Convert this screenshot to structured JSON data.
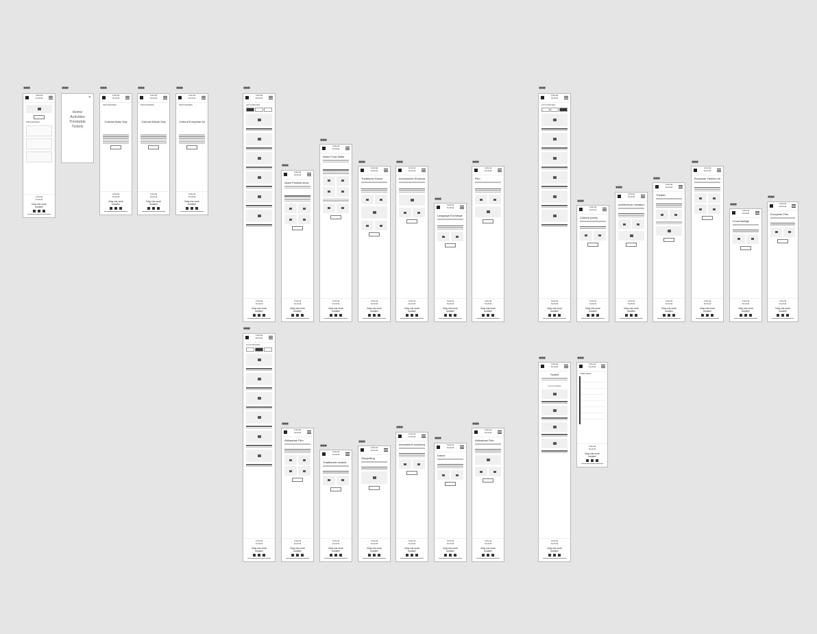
{
  "brand": "Cultural\nFestival",
  "menu_items": [
    "Home",
    "Activities",
    "Timetable",
    "Tickets"
  ],
  "titles": {
    "programma": "PROGRAMMA",
    "activiteiten": "ACTIVITEITEN",
    "tickets": "Tickets",
    "timetable": "TIMETABLE"
  },
  "pages": [
    "Cultural Asian Day",
    "Cultural African Day",
    "Cultural European Day",
    "Asian Festival show",
    "Asian Food Stalls",
    "Traditional Dance",
    "Accessories Showcase",
    "Language Exchange",
    "Film",
    "Cultural poetry",
    "Architecture miniature",
    "Theater",
    "European Fashion show",
    "Food tastings",
    "European Film",
    "Storytelling",
    "Interactieve workshop",
    "Dance",
    "Afrikaanse Film",
    "Traditionele muziek"
  ],
  "footer": {
    "name": "Cultural\nFestival",
    "follow": "Volg ons onze\nsocials!"
  },
  "ticket_section": "Current tickets"
}
